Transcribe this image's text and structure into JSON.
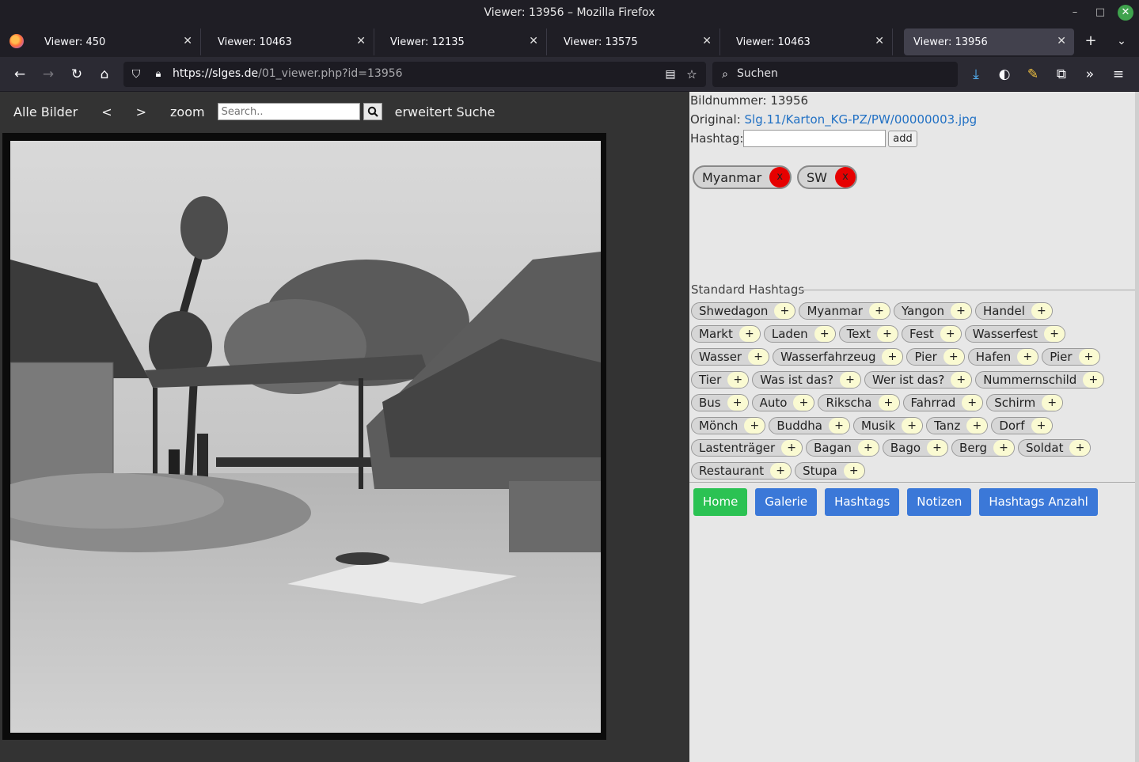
{
  "window": {
    "title": "Viewer: 13956 – Mozilla Firefox"
  },
  "tabs": [
    {
      "label": "Viewer: 450"
    },
    {
      "label": "Viewer: 10463"
    },
    {
      "label": "Viewer: 12135"
    },
    {
      "label": "Viewer: 13575"
    },
    {
      "label": "Viewer: 10463"
    },
    {
      "label": "Viewer: 13956"
    }
  ],
  "browser": {
    "url_host": "https://slges.de",
    "url_path": "/01_viewer.php?id=13956",
    "search_placeholder": "Suchen"
  },
  "site_nav": {
    "all_images": "Alle Bilder",
    "prev": "<",
    "next": ">",
    "zoom": "zoom",
    "search_placeholder": "Search..",
    "extended_search": "erweitert Suche"
  },
  "info": {
    "image_number": "Bildnummer: 13956",
    "original_label": "Original:",
    "original_link": "Slg.11/Karton_KG-PZ/PW/00000003.jpg",
    "hashtag_label": "Hashtag:",
    "add_label": "add"
  },
  "chosen_tags": [
    {
      "label": "Myanmar",
      "remove": "x"
    },
    {
      "label": "SW",
      "remove": "x"
    }
  ],
  "standard_title": "Standard Hashtags",
  "standard_rows": [
    [
      "Shwedagon",
      "Myanmar",
      "Yangon",
      "Handel"
    ],
    [
      "Markt",
      "Laden",
      "Text",
      "Fest",
      "Wasserfest"
    ],
    [
      "Wasser",
      "Wasserfahrzeug",
      "Pier",
      "Hafen",
      "Pier"
    ],
    [
      "Tier",
      "Was ist das?",
      "Wer ist das?",
      "Nummernschild"
    ],
    [
      "Bus",
      "Auto",
      "Rikscha",
      "Fahrrad",
      "Schirm"
    ],
    [
      "Mönch",
      "Buddha",
      "Musik",
      "Tanz",
      "Dorf"
    ],
    [
      "Lastenträger",
      "Bagan",
      "Bago",
      "Berg",
      "Soldat"
    ],
    [
      "Restaurant",
      "Stupa"
    ]
  ],
  "plus": "+",
  "menu": {
    "home": "Home",
    "gallery": "Galerie",
    "hashtags": "Hashtags",
    "notes": "Notizen",
    "hashtag_count": "Hashtags Anzahl"
  }
}
